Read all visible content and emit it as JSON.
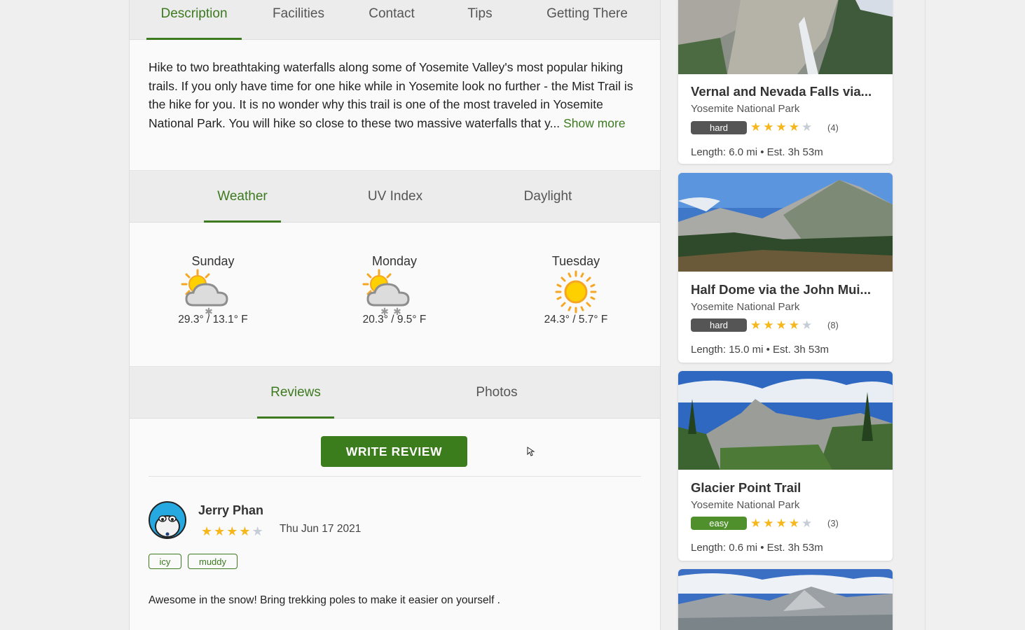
{
  "top_tabs": [
    {
      "label": "Description",
      "active": true
    },
    {
      "label": "Facilities",
      "active": false
    },
    {
      "label": "Contact",
      "active": false
    },
    {
      "label": "Tips",
      "active": false
    },
    {
      "label": "Getting There",
      "active": false
    }
  ],
  "description": {
    "text": "Hike to two breathtaking waterfalls along some of Yosemite Valley's most popular hiking trails. If you only have time for one hike while in Yosemite look no further - the Mist Trail is the hike for you. It is no wonder why this trail is one of the most traveled in Yosemite National Park. You will hike so close to these two massive waterfalls that y...",
    "show_more": "Show more"
  },
  "weather_tabs": [
    {
      "label": "Weather",
      "active": true
    },
    {
      "label": "UV Index",
      "active": false
    },
    {
      "label": "Daylight",
      "active": false
    }
  ],
  "forecast": [
    {
      "day": "Sunday",
      "icon": "partly-cloudy-snow-icon",
      "temp": "29.3° / 13.1° F"
    },
    {
      "day": "Monday",
      "icon": "partly-cloudy-snow-icon",
      "temp": "20.3° / 9.5° F"
    },
    {
      "day": "Tuesday",
      "icon": "sun-icon",
      "temp": "24.3° / 5.7° F"
    }
  ],
  "review_tabs": [
    {
      "label": "Reviews",
      "active": true
    },
    {
      "label": "Photos",
      "active": false
    }
  ],
  "write_review_label": "WRITE REVIEW",
  "review": {
    "author": "Jerry Phan",
    "rating": 4,
    "max_rating": 5,
    "date": "Thu Jun 17 2021",
    "tags": [
      "icy",
      "muddy"
    ],
    "text": "Awesome in the snow! Bring trekking poles to make it easier on yourself ."
  },
  "trail_cards": [
    {
      "title": "Vernal and Nevada Falls via...",
      "park": "Yosemite National Park",
      "difficulty": "hard",
      "difficulty_color": "#555555",
      "rating": 4,
      "count": "(4)",
      "length": "Length: 6.0 mi",
      "est": "Est. 3h 53m"
    },
    {
      "title": "Half Dome via the John Mui...",
      "park": "Yosemite National Park",
      "difficulty": "hard",
      "difficulty_color": "#555555",
      "rating": 4,
      "count": "(8)",
      "length": "Length: 15.0 mi",
      "est": "Est. 3h 53m"
    },
    {
      "title": "Glacier Point Trail",
      "park": "Yosemite National Park",
      "difficulty": "easy",
      "difficulty_color": "#4f8f2c",
      "rating": 4,
      "count": "(3)",
      "length": "Length: 0.6 mi",
      "est": "Est. 3h 53m"
    }
  ],
  "colors": {
    "accent_green": "#3d7a1f",
    "star_gold": "#f5b71c",
    "star_gray": "#c6cdd6"
  }
}
